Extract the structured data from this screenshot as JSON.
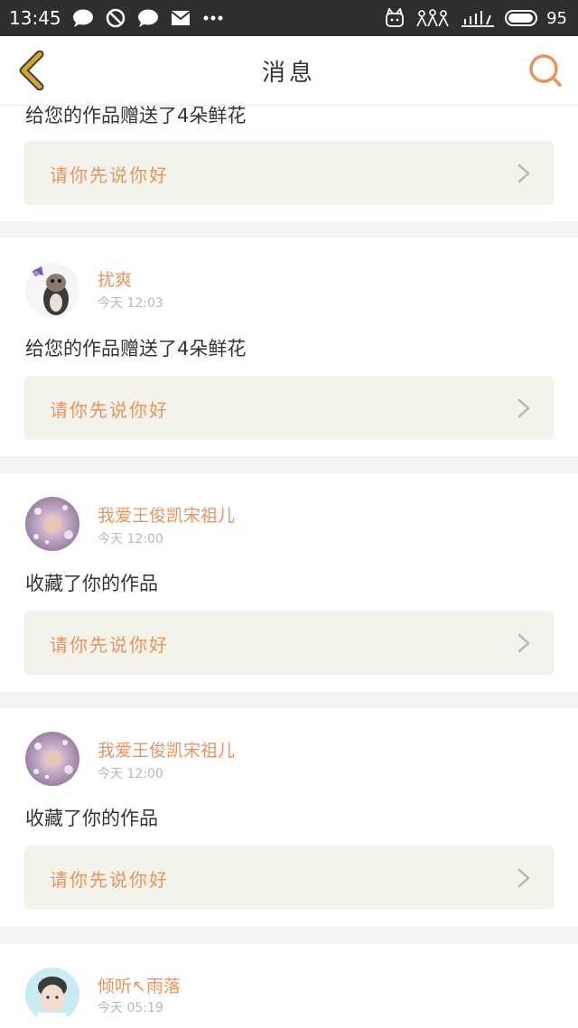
{
  "status_bar": {
    "time": "13:45",
    "battery": "95",
    "battery_level": 0.95,
    "left_icons": [
      "chat-bubble-icon",
      "block-icon",
      "chat-bubble-icon",
      "mail-icon",
      "more-dots-icon"
    ],
    "right_icons": [
      "cat-sticker-icon",
      "family-sticker-icon",
      "signal-doodle-icon"
    ]
  },
  "nav": {
    "title": "消息",
    "back_icon": "chevron-left-icon",
    "search_icon": "search-icon",
    "accent_color": "#e8945f",
    "back_color": "#d4a526"
  },
  "messages": [
    {
      "user": "",
      "time": "",
      "text": "给您的作品赠送了4朵鲜花",
      "reply_label": "请你先说你好",
      "avatar": "none"
    },
    {
      "user": "扰爽",
      "time": "今天 12:03",
      "text": "给您的作品赠送了4朵鲜花",
      "reply_label": "请你先说你好",
      "avatar": "cat-avatar"
    },
    {
      "user": "我爱王俊凯宋祖儿",
      "time": "今天 12:00",
      "text": "收藏了你的作品",
      "reply_label": "请你先说你好",
      "avatar": "sparkle-avatar"
    },
    {
      "user": "我爱王俊凯宋祖儿",
      "time": "今天 12:00",
      "text": "收藏了你的作品",
      "reply_label": "请你先说你好",
      "avatar": "sparkle-avatar"
    },
    {
      "user": "倾听↖雨落",
      "time": "今天 05:19",
      "text": "",
      "reply_label": "",
      "avatar": "boy-avatar"
    }
  ]
}
